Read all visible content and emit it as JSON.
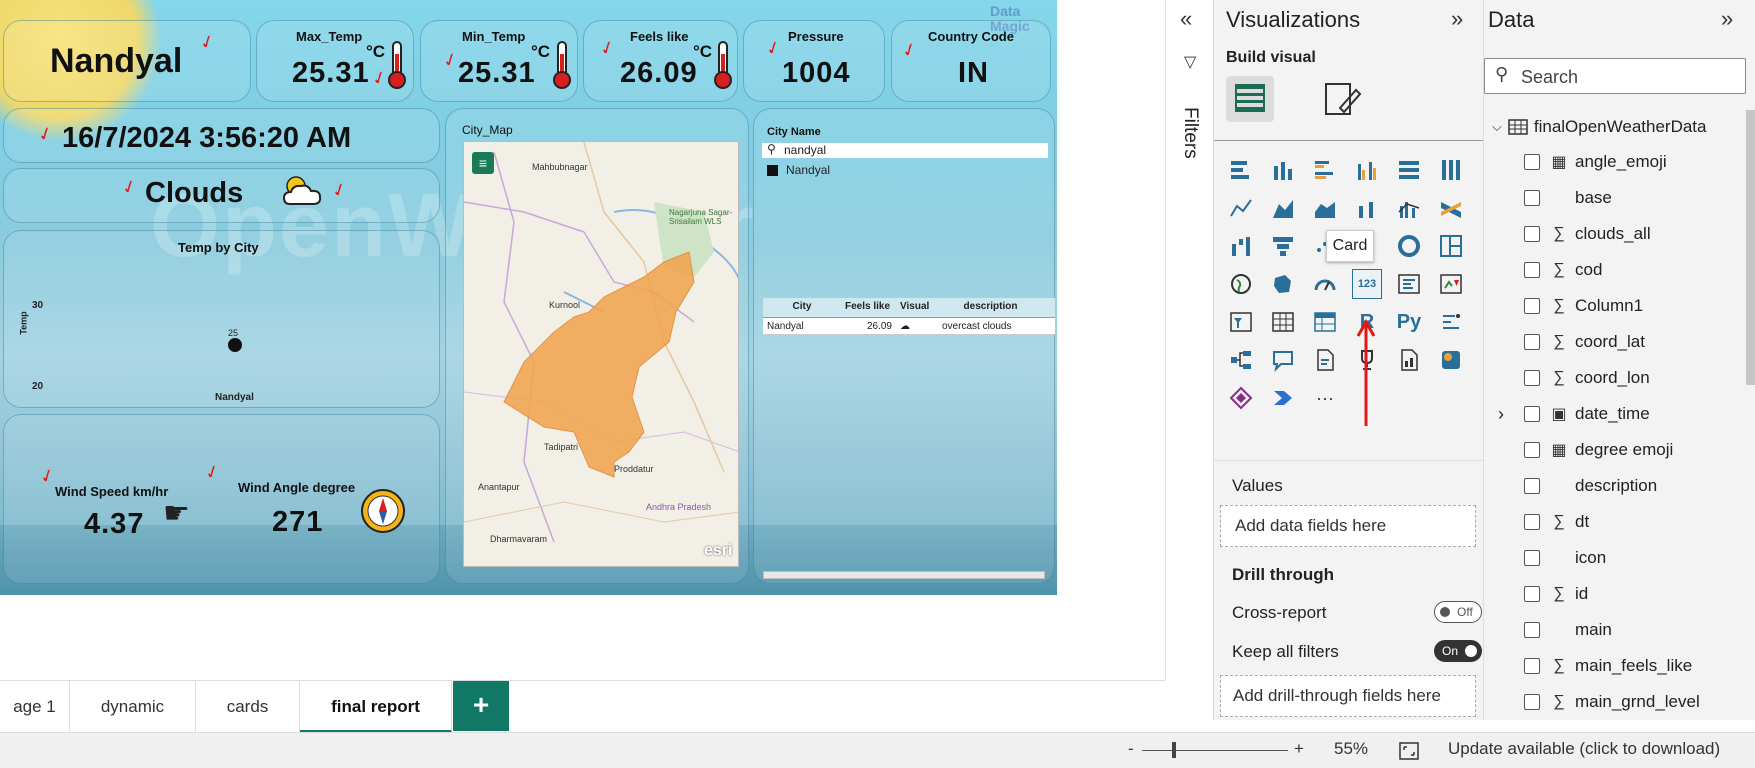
{
  "report": {
    "city": "Nandyal",
    "datetime": "16/7/2024 3:56:20 AM",
    "weather": "Clouds",
    "watermark": "OpenWeather",
    "logo": "Data Magic",
    "cards": [
      {
        "label": "Max_Temp",
        "value": "25.31",
        "unit": "°C"
      },
      {
        "label": "Min_Temp",
        "value": "25.31",
        "unit": "°C"
      },
      {
        "label": "Feels like",
        "value": "26.09",
        "unit": "°C"
      },
      {
        "label": "Pressure",
        "value": "1004",
        "unit": ""
      },
      {
        "label": "Country Code",
        "value": "IN",
        "unit": ""
      }
    ],
    "temp_chart": {
      "title": "Temp by City",
      "ylabel": "Temp",
      "ytick_top": "30",
      "ytick_bottom": "20",
      "point_label": "25",
      "category": "Nandyal"
    },
    "wind": {
      "speed_label": "Wind Speed km/hr",
      "speed": "4.37",
      "angle_label": "Wind Angle degree",
      "angle": "271"
    },
    "map": {
      "title": "City_Map",
      "places": [
        "Mahbubnagar",
        "Nagarjuna Sagar-Srisailam WLS",
        "Kurnool",
        "Tadipatri",
        "Anantapur",
        "Proddatur",
        "Andhra Pradesh",
        "Dharmavaram"
      ],
      "attribution": "esri"
    },
    "slicer": {
      "title": "City Name",
      "search": "nandyal",
      "item": "Nandyal"
    },
    "table": {
      "headers": [
        "City",
        "Feels like",
        "Visual",
        "description"
      ],
      "rows": [
        [
          "Nandyal",
          "26.09",
          "☁",
          "overcast clouds"
        ]
      ]
    }
  },
  "filters_label": "Filters",
  "visualizations": {
    "title": "Visualizations",
    "build_visual": "Build visual",
    "tooltip": "Card",
    "values_label": "Values",
    "values_placeholder": "Add data fields here",
    "drill_through": "Drill through",
    "cross_report": "Cross-report",
    "cross_report_state": "Off",
    "keep_filters": "Keep all filters",
    "keep_filters_state": "On",
    "drill_placeholder": "Add drill-through fields here",
    "more": "···"
  },
  "data_pane": {
    "title": "Data",
    "search_placeholder": "Search",
    "table": "finalOpenWeatherData",
    "fields": [
      {
        "name": "angle_emoji",
        "type": "calc"
      },
      {
        "name": "base",
        "type": "text"
      },
      {
        "name": "clouds_all",
        "type": "sum"
      },
      {
        "name": "cod",
        "type": "sum"
      },
      {
        "name": "Column1",
        "type": "sum"
      },
      {
        "name": "coord_lat",
        "type": "sum"
      },
      {
        "name": "coord_lon",
        "type": "sum"
      },
      {
        "name": "date_time",
        "type": "date"
      },
      {
        "name": "degree emoji",
        "type": "calc"
      },
      {
        "name": "description",
        "type": "text"
      },
      {
        "name": "dt",
        "type": "sum"
      },
      {
        "name": "icon",
        "type": "text"
      },
      {
        "name": "id",
        "type": "sum"
      },
      {
        "name": "main",
        "type": "text"
      },
      {
        "name": "main_feels_like",
        "type": "sum"
      },
      {
        "name": "main_grnd_level",
        "type": "sum"
      }
    ]
  },
  "tabs": [
    "age 1",
    "dynamic",
    "cards",
    "final report"
  ],
  "active_tab": "final report",
  "status": {
    "zoom": "55%",
    "update": "Update available (click to download)"
  }
}
